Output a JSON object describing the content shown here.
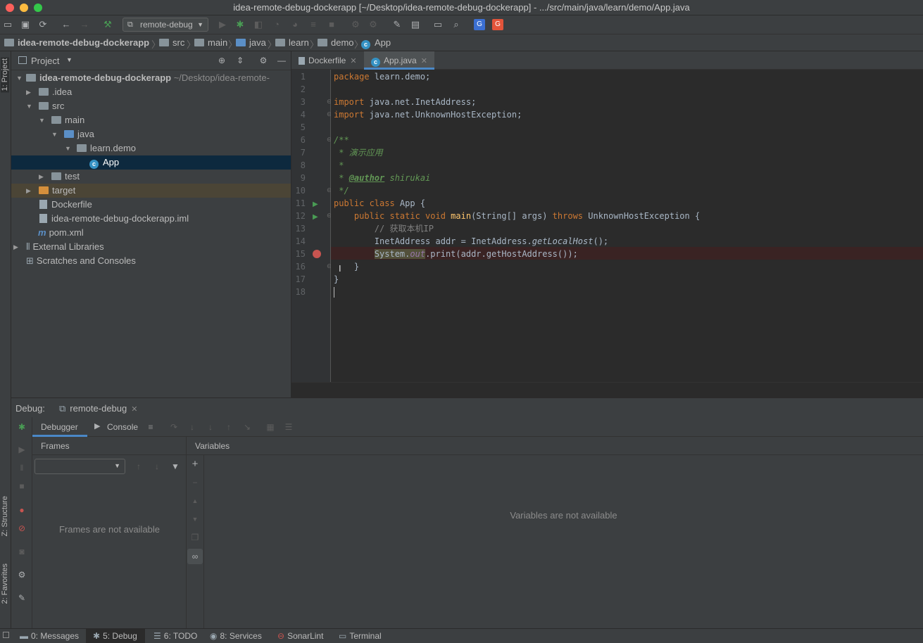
{
  "window": {
    "title": "idea-remote-debug-dockerapp [~/Desktop/idea-remote-debug-dockerapp] - .../src/main/java/learn/demo/App.java"
  },
  "toolbar": {
    "run_config": "remote-debug"
  },
  "breadcrumb": [
    "idea-remote-debug-dockerapp",
    "src",
    "main",
    "java",
    "learn",
    "demo",
    "App"
  ],
  "project_panel": {
    "title": "Project",
    "tree": [
      {
        "label": "idea-remote-debug-dockerapp",
        "suffix": "~/Desktop/idea-remote-",
        "depth": 0
      },
      {
        "label": ".idea",
        "depth": 1
      },
      {
        "label": "src",
        "depth": 1
      },
      {
        "label": "main",
        "depth": 2
      },
      {
        "label": "java",
        "depth": 3
      },
      {
        "label": "learn.demo",
        "depth": 4
      },
      {
        "label": "App",
        "depth": 5
      },
      {
        "label": "test",
        "depth": 2
      },
      {
        "label": "target",
        "depth": 1
      },
      {
        "label": "Dockerfile",
        "depth": 1
      },
      {
        "label": "idea-remote-debug-dockerapp.iml",
        "depth": 1
      },
      {
        "label": "pom.xml",
        "depth": 1
      },
      {
        "label": "External Libraries",
        "depth": 0
      },
      {
        "label": "Scratches and Consoles",
        "depth": 0
      }
    ]
  },
  "side_tabs": {
    "project": "1: Project",
    "structure": "Z: Structure",
    "favorites": "2: Favorites"
  },
  "editor_tabs": [
    {
      "label": "Dockerfile"
    },
    {
      "label": "App.java"
    }
  ],
  "line_numbers": [
    "1",
    "2",
    "3",
    "4",
    "5",
    "6",
    "7",
    "8",
    "9",
    "10",
    "11",
    "12",
    "13",
    "14",
    "15",
    "16",
    "17",
    "18"
  ],
  "code": {
    "l1_kw": "package",
    "l1_rest": " learn.demo;",
    "l3_kw": "import",
    "l3_rest": " java.net.InetAddress;",
    "l4_kw": "import",
    "l4_rest": " java.net.UnknownHostException;",
    "l6": "/**",
    "l7": " * 演示应用",
    "l8": " *",
    "l9_pre": " * ",
    "l9_tag": "@author",
    "l9_rest": " shirukai",
    "l10": " */",
    "l11_kw": "public class",
    "l11_rest": " App {",
    "l12_indent": "    ",
    "l12_kw": "public static void",
    "l12_fn": " main",
    "l12_mid": "(String[] args) ",
    "l12_kw2": "throws",
    "l12_rest": " UnknownHostException {",
    "l13": "        // 获取本机IP",
    "l14_pre": "        InetAddress addr = InetAddress.",
    "l14_it": "getLocalHost",
    "l14_rest": "();",
    "l15_indent": "        ",
    "l15_sys": "System.",
    "l15_out": "out",
    "l15_rest": ".print(addr.getHostAddress());",
    "l16": "    }",
    "l17": "}"
  },
  "debug": {
    "label": "Debug:",
    "session": "remote-debug",
    "tab_debugger": "Debugger",
    "tab_console": "Console",
    "frames_title": "Frames",
    "frames_empty": "Frames are not available",
    "variables_title": "Variables",
    "variables_empty": "Variables are not available"
  },
  "statusbar": {
    "messages": "0: Messages",
    "debug": "5: Debug",
    "todo": "6: TODO",
    "services": "8: Services",
    "sonarlint": "SonarLint",
    "terminal": "Terminal"
  },
  "colors": {
    "accent": "#4a88c7",
    "breakpoint": "#c75450",
    "run_green": "#499c54"
  }
}
